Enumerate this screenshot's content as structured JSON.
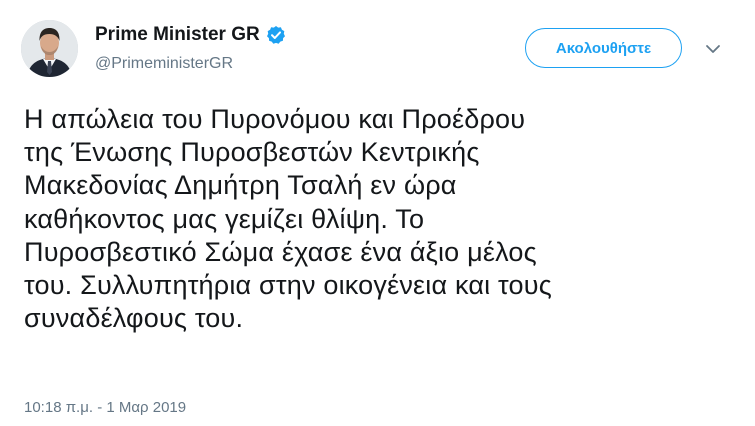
{
  "user": {
    "display_name": "Prime Minister GR",
    "handle": "@PrimeministerGR",
    "verified_icon": "verified-badge-icon",
    "avatar_icon": "profile-photo"
  },
  "follow_button": {
    "label": "Ακολουθήστε"
  },
  "menu": {
    "icon": "chevron-down-icon"
  },
  "tweet": {
    "lines": [
      "Η απώλεια του Πυρονόμου και Προέδρου",
      "της Ένωσης Πυροσβεστών Κεντρικής",
      "Μακεδονίας Δημήτρη Τσαλή εν ώρα",
      "καθήκοντος μας γεμίζει θλίψη. Το",
      "Πυροσβεστικό Σώμα έχασε ένα άξιο μέλος",
      "του. Συλλυπητήρια στην οικογένεια και τους",
      "συναδέλφους του."
    ],
    "timestamp": "10:18 π.μ. - 1 Μαρ 2019"
  },
  "colors": {
    "accent": "#1da1f2",
    "text": "#14171a",
    "secondary_text": "#657786"
  }
}
